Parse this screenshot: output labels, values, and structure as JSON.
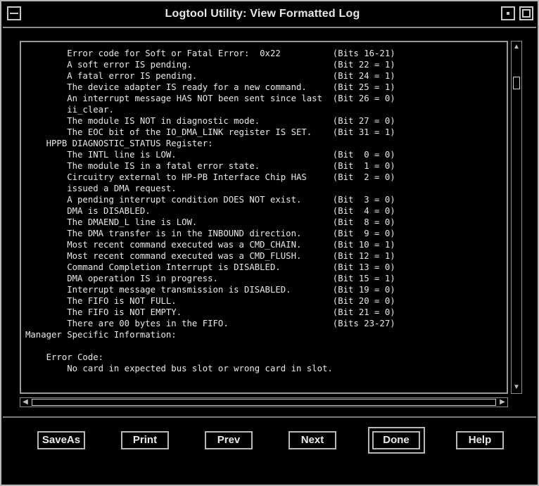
{
  "window": {
    "title": "Logtool Utility: View Formatted Log"
  },
  "log": {
    "lines": [
      "        Error code for Soft or Fatal Error:  0x22          (Bits 16-21)",
      "        A soft error IS pending.                           (Bit 22 = 1)",
      "        A fatal error IS pending.                          (Bit 24 = 1)",
      "        The device adapter IS ready for a new command.     (Bit 25 = 1)",
      "        An interrupt message HAS NOT been sent since last  (Bit 26 = 0)",
      "        ii_clear.",
      "        The module IS NOT in diagnostic mode.              (Bit 27 = 0)",
      "        The EOC bit of the IO_DMA_LINK register IS SET.    (Bit 31 = 1)",
      "    HPPB DIAGNOSTIC_STATUS Register:",
      "        The INTL line is LOW.                              (Bit  0 = 0)",
      "        The module IS in a fatal error state.              (Bit  1 = 0)",
      "        Circuitry external to HP-PB Interface Chip HAS     (Bit  2 = 0)",
      "        issued a DMA request.",
      "        A pending interrupt condition DOES NOT exist.      (Bit  3 = 0)",
      "        DMA is DISABLED.                                   (Bit  4 = 0)",
      "        The DMAEND_L line is LOW.                          (Bit  8 = 0)",
      "        The DMA transfer is in the INBOUND direction.      (Bit  9 = 0)",
      "        Most recent command executed was a CMD_CHAIN.      (Bit 10 = 1)",
      "        Most recent command executed was a CMD_FLUSH.      (Bit 12 = 1)",
      "        Command Completion Interrupt is DISABLED.          (Bit 13 = 0)",
      "        DMA operation IS in progress.                      (Bit 15 = 1)",
      "        Interrupt message transmission is DISABLED.        (Bit 19 = 0)",
      "        The FIFO is NOT FULL.                              (Bit 20 = 0)",
      "        The FIFO is NOT EMPTY.                             (Bit 21 = 0)",
      "        There are 00 bytes in the FIFO.                    (Bits 23-27)",
      "Manager Specific Information:",
      "",
      "    Error Code:",
      "        No card in expected bus slot or wrong card in slot."
    ]
  },
  "buttons": {
    "saveas": "SaveAs",
    "print": "Print",
    "prev": "Prev",
    "next": "Next",
    "done": "Done",
    "help": "Help"
  }
}
